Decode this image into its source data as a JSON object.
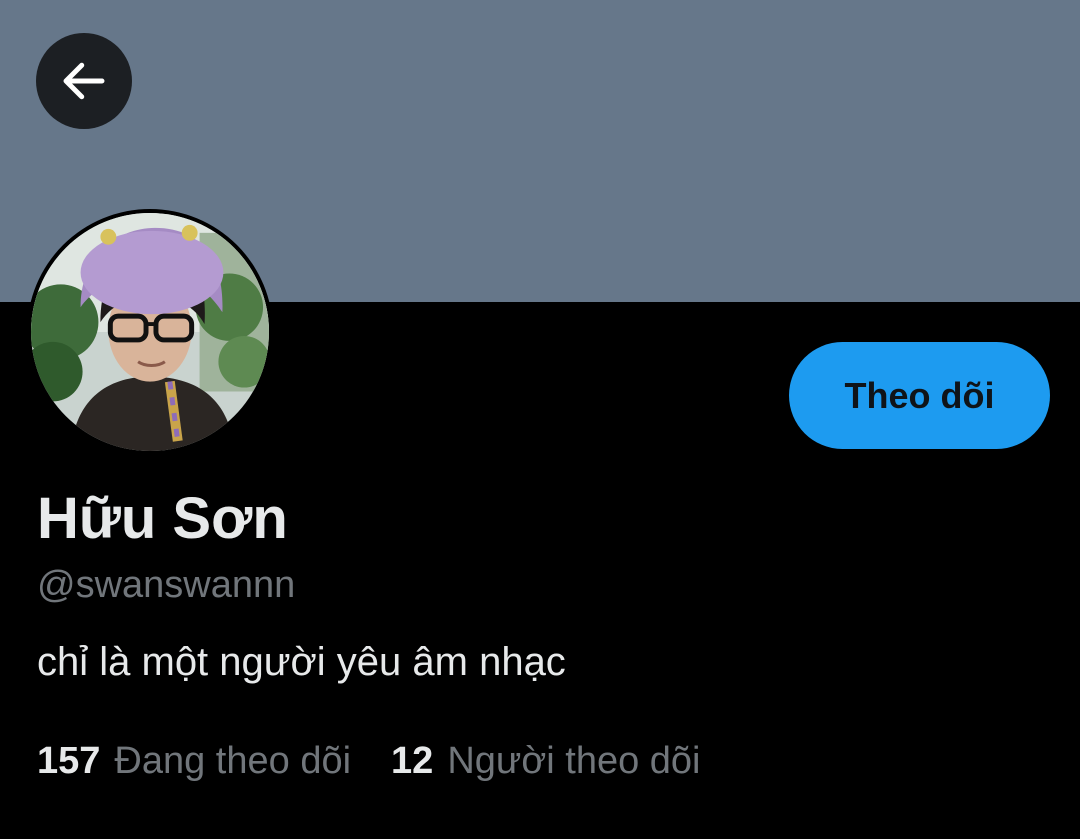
{
  "profile": {
    "display_name": "Hữu Sơn",
    "handle": "@swanswannn",
    "bio": "chỉ là một người yêu âm nhạc"
  },
  "actions": {
    "back_icon": "arrow-left-icon",
    "follow_label": "Theo dõi"
  },
  "stats": {
    "following_count": "157",
    "following_label": "Đang theo dõi",
    "followers_count": "12",
    "followers_label": "Người theo dõi"
  },
  "colors": {
    "banner": "#66778a",
    "background": "#000000",
    "accent": "#1d9bf0",
    "primary_text": "#e7e9ea",
    "secondary_text": "#71767b"
  }
}
